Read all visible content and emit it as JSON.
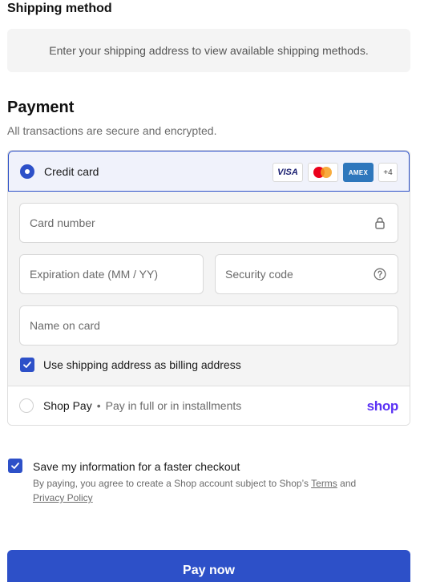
{
  "shipping": {
    "title": "Shipping method",
    "message": "Enter your shipping address to view available shipping methods."
  },
  "payment": {
    "title": "Payment",
    "subtitle": "All transactions are secure and encrypted.",
    "credit_card": {
      "label": "Credit card",
      "selected": true,
      "card_brands": [
        "VISA",
        "mastercard",
        "AMEX"
      ],
      "more_brands": "+4"
    },
    "fields": {
      "card_number": "Card number",
      "expiration": "Expiration date (MM / YY)",
      "security_code": "Security code",
      "name_on_card": "Name on card"
    },
    "billing_checkbox": {
      "label": "Use shipping address as billing address",
      "checked": true
    },
    "shop_pay": {
      "label": "Shop Pay",
      "separator": "•",
      "description": "Pay in full or in installments",
      "logo": "shop"
    }
  },
  "save_info": {
    "label": "Save my information for a faster checkout",
    "checked": true,
    "legal_prefix": "By paying, you agree to create a Shop account subject to Shop’s",
    "terms_link": "Terms",
    "legal_and": "and",
    "privacy_link": "Privacy Policy"
  },
  "pay_button": "Pay now",
  "colors": {
    "accent": "#2d50c8",
    "shop_purple": "#5a31f4"
  }
}
